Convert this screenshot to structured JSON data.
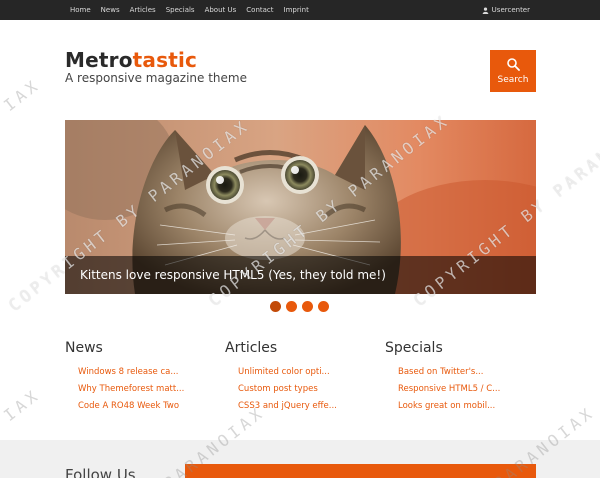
{
  "nav": {
    "items": [
      "Home",
      "News",
      "Articles",
      "Specials",
      "About Us",
      "Contact",
      "Imprint"
    ],
    "usercenter": "Usercenter"
  },
  "header": {
    "brand_main": "Metro",
    "brand_accent": "tastic",
    "tagline": "A responsive magazine theme",
    "search_label": "Search"
  },
  "slider": {
    "caption": "Kittens love responsive HTML5 (Yes, they told me!)",
    "dots": 4,
    "active_dot": 0
  },
  "columns": [
    {
      "title": "News",
      "items": [
        "Windows 8 release ca...",
        "Why Themeforest matt...",
        "Code A RO48 Week Two"
      ]
    },
    {
      "title": "Articles",
      "items": [
        "Unlimited color opti...",
        "Custom post types",
        "CSS3 and jQuery effe..."
      ]
    },
    {
      "title": "Specials",
      "items": [
        "Based on Twitter's...",
        "Responsive HTML5 / C...",
        "Looks great on mobil..."
      ]
    }
  ],
  "footer": {
    "follow": "Follow Us"
  },
  "watermarks": [
    "COPYRIGHT BY PARANOIAX",
    "COPYRIGHT BY PARANOIAX",
    "COPYRIGHT BY PARANOIAX",
    "PARANOIAX",
    "PARANOIAX",
    "IAX",
    "IAX"
  ],
  "colors": {
    "accent": "#e8590c",
    "topbar": "#262626",
    "footer_band": "#f0f0f0"
  }
}
